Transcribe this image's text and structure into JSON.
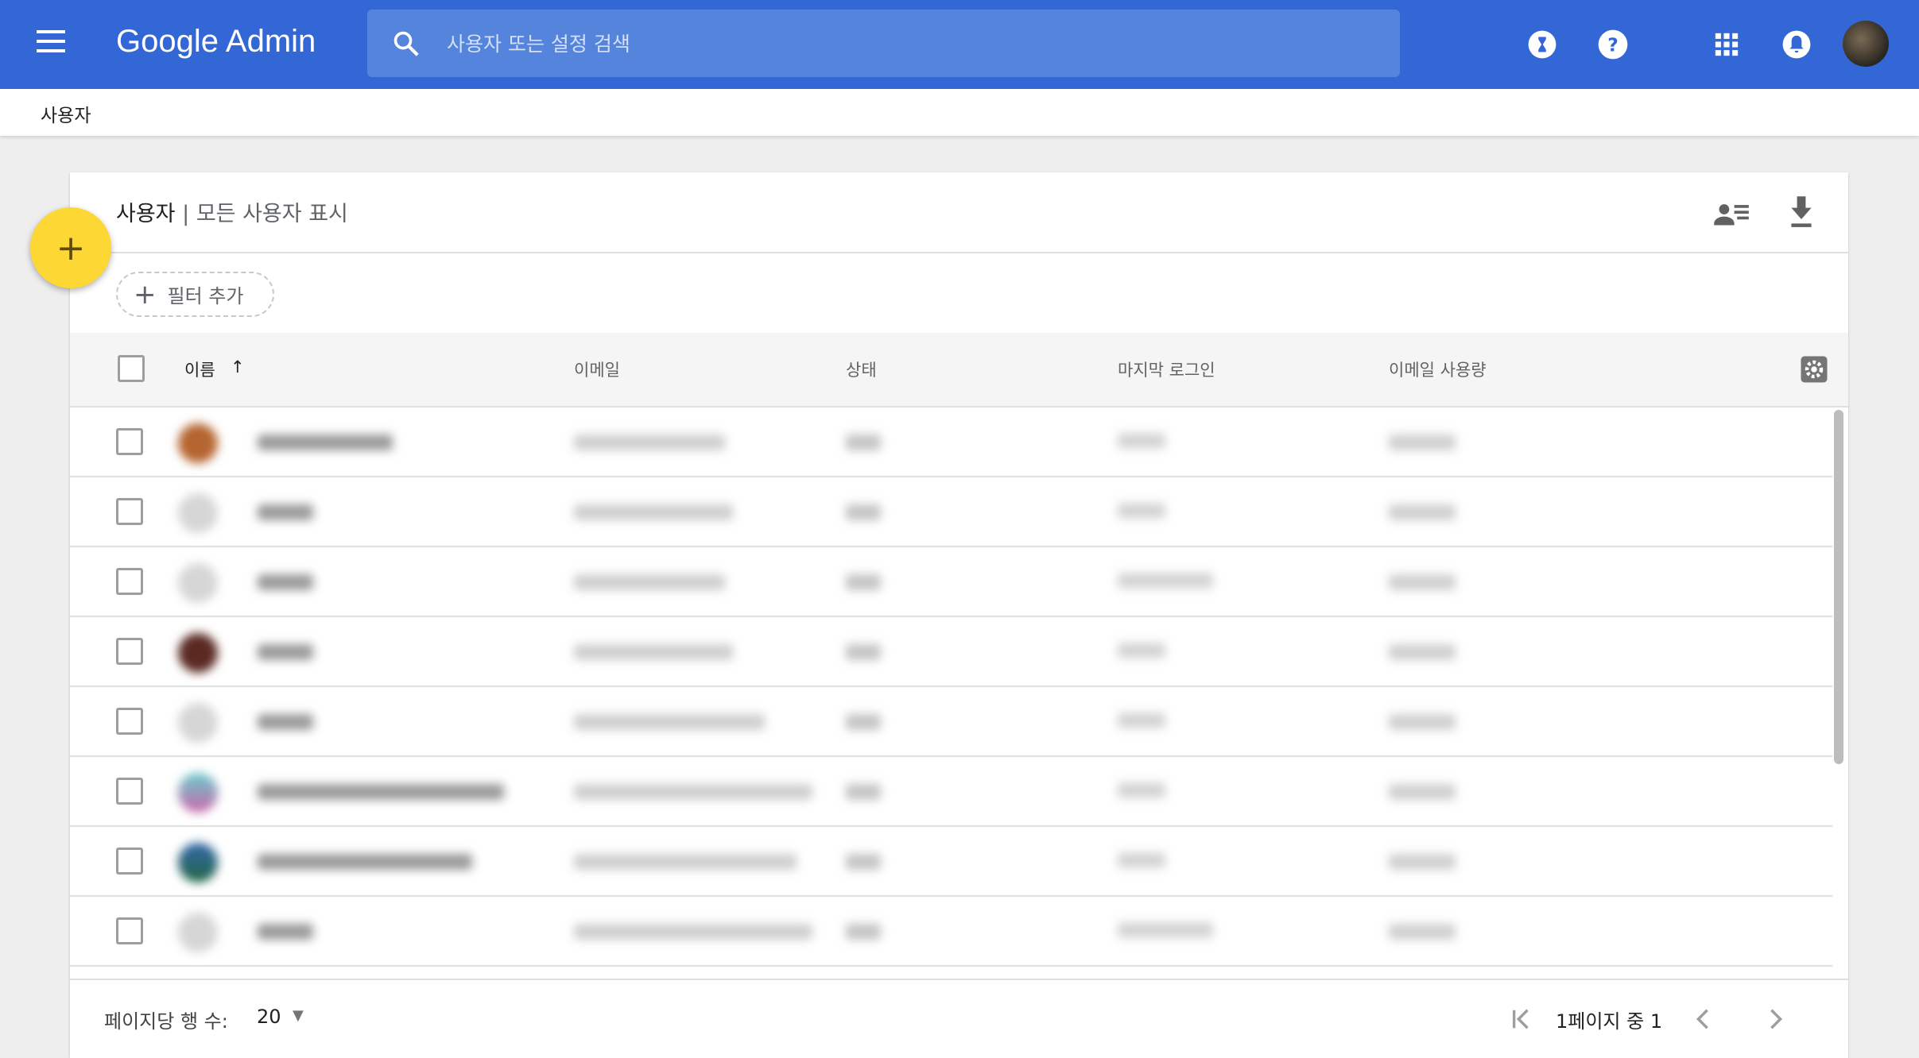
{
  "header": {
    "app_title": "Google Admin",
    "search_placeholder": "사용자 또는 설정 검색",
    "icons": [
      "menu-icon",
      "search-icon",
      "hourglass-icon",
      "help-icon",
      "apps-grid-icon",
      "notifications-icon",
      "avatar"
    ],
    "brand_color": "#3367d6"
  },
  "breadcrumb": {
    "current": "사용자"
  },
  "card": {
    "title": "사용자",
    "subtitle": "모든 사용자 표시",
    "separator": "|",
    "add_filter": "필터 추가",
    "fab_label": "+",
    "fab_color": "#fdd835"
  },
  "table": {
    "columns": [
      "이름",
      "이메일",
      "상태",
      "마지막 로그인",
      "이메일 사용량"
    ],
    "sort_indicator": "↑",
    "row_count_visible": 8
  },
  "footer": {
    "rows_per_page_label": "페이지당 행 수:",
    "rows_per_page": "20",
    "page_info": "1페이지 중 1"
  }
}
